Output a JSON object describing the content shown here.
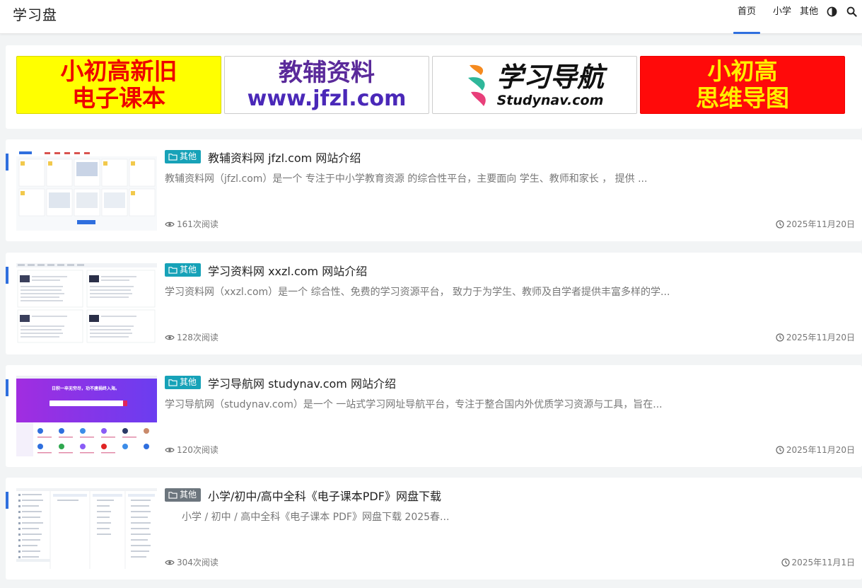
{
  "header": {
    "logo": "学习盘",
    "nav": [
      "首页",
      "小学",
      "其他"
    ]
  },
  "banners": {
    "ad1": [
      "小初高新旧",
      "电子课本"
    ],
    "ad2": [
      "教辅资料",
      "www.jfzl.com"
    ],
    "ad3": [
      "学习导航",
      "Studynav.com"
    ],
    "ad4": [
      "小初高",
      "思维导图"
    ]
  },
  "posts": [
    {
      "category": "其他",
      "title": "教辅资料网 jfzl.com 网站介绍",
      "excerpt": "教辅资料网（jfzl.com）是一个 专注于中小学教育资源 的综合性平台，主要面向 学生、教师和家长 ， 提供 ...",
      "views": "161次阅读",
      "date": "2025年11月20日"
    },
    {
      "category": "其他",
      "title": "学习资料网 xxzl.com 网站介绍",
      "excerpt": "学习资料网（xxzl.com）是一个 综合性、免费的学习资源平台， 致力于为学生、教师及自学者提供丰富多样的学...",
      "views": "128次阅读",
      "date": "2025年11月20日"
    },
    {
      "category": "其他",
      "title": "学习导航网 studynav.com 网站介绍",
      "excerpt": "学习导航网（studynav.com）是一个 一站式学习网址导航平台，专注于整合国内外优质学习资源与工具，旨在...",
      "views": "120次阅读",
      "date": "2025年11月20日",
      "thumb_text": "日积一卒无穷尽，功不唐捐终入海。"
    },
    {
      "category": "其他",
      "title": "小学/初中/高中全科《电子课本PDF》网盘下载",
      "excerpt": "小学 / 初中 / 高中全科《电子课本 PDF》网盘下载 2025春...",
      "views": "304次阅读",
      "date": "2025年11月1日"
    }
  ],
  "colors": {
    "accent": "#2f6fde",
    "badge_teal": "#17a2b8",
    "badge_gray": "#6c757d"
  },
  "icons": [
    "folder-icon",
    "eye-icon",
    "clock-icon",
    "theme-toggle-icon",
    "search-icon"
  ]
}
